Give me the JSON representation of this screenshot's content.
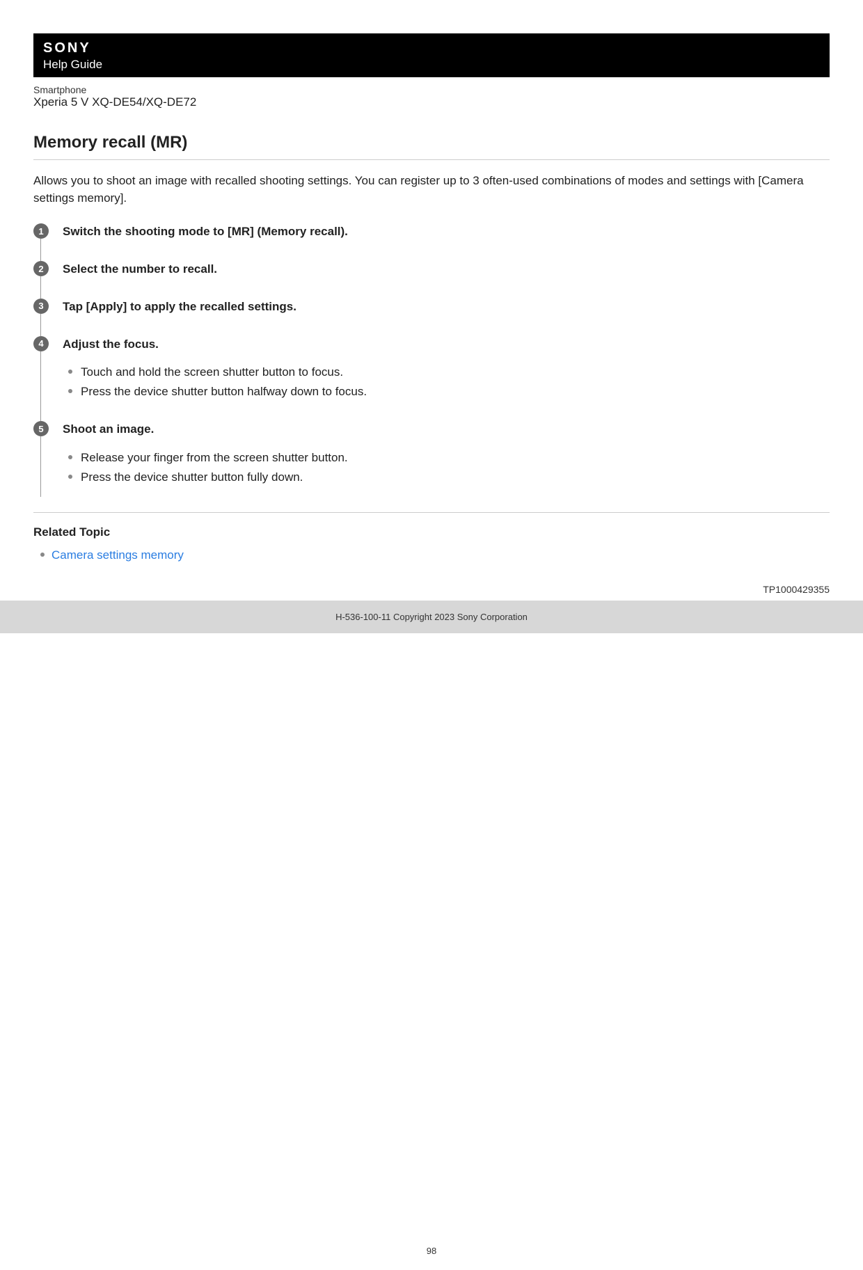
{
  "header": {
    "brand": "SONY",
    "title": "Help Guide"
  },
  "meta": {
    "category": "Smartphone",
    "model": "Xperia 5 V XQ-DE54/XQ-DE72"
  },
  "pageTitle": "Memory recall (MR)",
  "intro": "Allows you to shoot an image with recalled shooting settings. You can register up to 3 often-used combinations of modes and settings with [Camera settings memory].",
  "steps": [
    {
      "number": "1",
      "title": "Switch the shooting mode to [MR] (Memory recall).",
      "subs": []
    },
    {
      "number": "2",
      "title": "Select the number to recall.",
      "subs": []
    },
    {
      "number": "3",
      "title": "Tap [Apply] to apply the recalled settings.",
      "subs": []
    },
    {
      "number": "4",
      "title": "Adjust the focus.",
      "subs": [
        "Touch and hold the screen shutter button to focus.",
        "Press the device shutter button halfway down to focus."
      ]
    },
    {
      "number": "5",
      "title": "Shoot an image.",
      "subs": [
        "Release your finger from the screen shutter button.",
        "Press the device shutter button fully down."
      ]
    }
  ],
  "related": {
    "title": "Related Topic",
    "items": [
      "Camera settings memory"
    ]
  },
  "docId": "TP1000429355",
  "copyright": "H-536-100-11 Copyright 2023 Sony Corporation",
  "pageNumber": "98"
}
